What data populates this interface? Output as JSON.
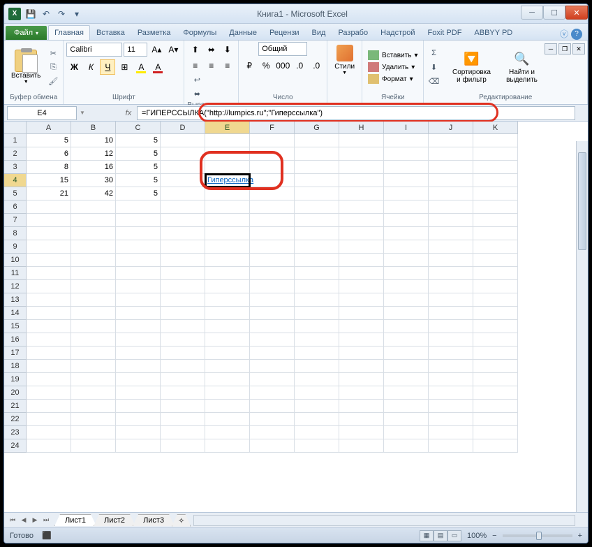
{
  "title": "Книга1 - Microsoft Excel",
  "tabs": {
    "file": "Файл",
    "list": [
      "Главная",
      "Вставка",
      "Разметка",
      "Формулы",
      "Данные",
      "Рецензи",
      "Вид",
      "Разрабо",
      "Надстрой",
      "Foxit PDF",
      "ABBYY PD"
    ],
    "active": 0
  },
  "ribbon": {
    "clipboard": {
      "paste": "Вставить",
      "label": "Буфер обмена"
    },
    "font": {
      "name": "Calibri",
      "size": "11",
      "label": "Шрифт"
    },
    "align": {
      "label": "Выравнивание"
    },
    "number": {
      "format": "Общий",
      "label": "Число"
    },
    "styles": {
      "btn": "Стили"
    },
    "cells": {
      "insert": "Вставить",
      "delete": "Удалить",
      "format": "Формат",
      "label": "Ячейки"
    },
    "editing": {
      "sort": "Сортировка и фильтр",
      "find": "Найти и выделить",
      "label": "Редактирование"
    }
  },
  "namebox": "E4",
  "formula": "=ГИПЕРССЫЛКА(\"http://lumpics.ru\";\"Гиперссылка\")",
  "columns": [
    "A",
    "B",
    "C",
    "D",
    "E",
    "F",
    "G",
    "H",
    "I",
    "J",
    "K"
  ],
  "activeCol": 4,
  "activeRow": 4,
  "data": {
    "1": {
      "A": "5",
      "B": "10",
      "C": "5"
    },
    "2": {
      "A": "6",
      "B": "12",
      "C": "5"
    },
    "3": {
      "A": "8",
      "B": "16",
      "C": "5"
    },
    "4": {
      "A": "15",
      "B": "30",
      "C": "5",
      "E": "Гиперссылка"
    },
    "5": {
      "A": "21",
      "B": "42",
      "C": "5"
    }
  },
  "rowCount": 24,
  "sheets": [
    "Лист1",
    "Лист2",
    "Лист3"
  ],
  "activeSheet": 0,
  "status": "Готово",
  "zoom": "100%"
}
